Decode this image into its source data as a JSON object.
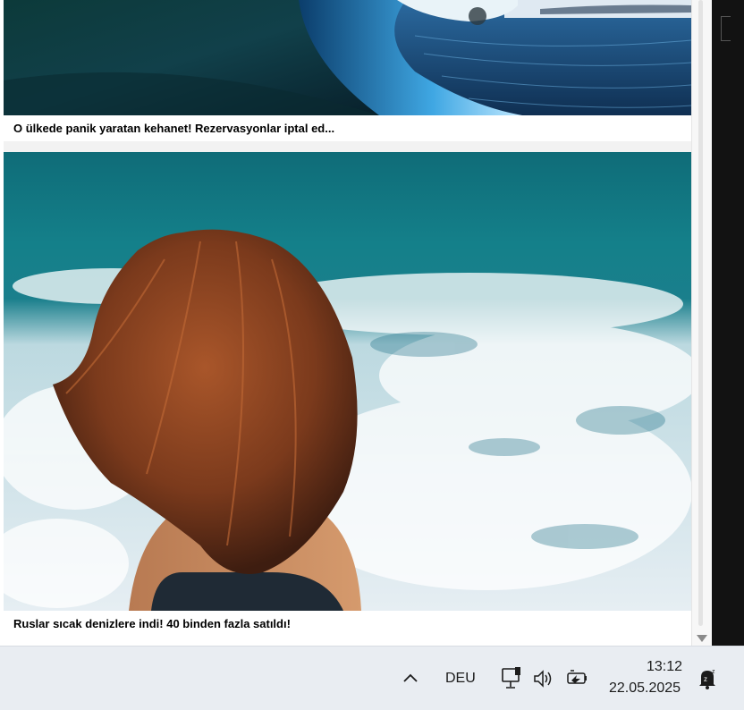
{
  "news_feed": {
    "items": [
      {
        "title": "O ülkede panik yaratan kehanet! Rezervasyonlar iptal ed...",
        "image": "ocean-wave-photo"
      },
      {
        "title": "Ruslar sıcak denizlere indi! 40 binden fazla satıldı!",
        "image": "woman-at-sea-photo"
      }
    ]
  },
  "taskbar": {
    "language": "DEU",
    "time": "13:12",
    "date": "22.05.2025",
    "icons": [
      "chevron-up-icon",
      "network-icon",
      "volume-icon",
      "battery-icon",
      "notification-bell-icon"
    ]
  }
}
